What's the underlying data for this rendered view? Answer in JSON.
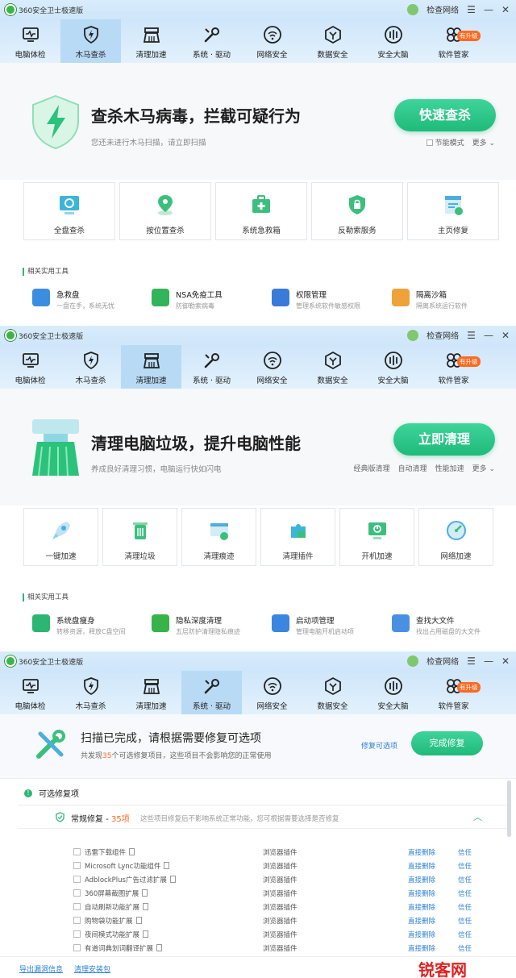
{
  "app_title": "360安全卫士极速版",
  "titlebar": {
    "network_check": "检查网络",
    "menu_icon": "☰",
    "min_icon": "—",
    "close_icon": "✕"
  },
  "nav": [
    {
      "label": "电脑体检",
      "icon": "monitor-icon"
    },
    {
      "label": "木马查杀",
      "icon": "shield-bolt-icon"
    },
    {
      "label": "清理加速",
      "icon": "broom-icon"
    },
    {
      "label": "系统 · 驱动",
      "icon": "wrench-icon"
    },
    {
      "label": "网络安全",
      "icon": "wifi-icon"
    },
    {
      "label": "数据安全",
      "icon": "data-shield-icon"
    },
    {
      "label": "安全大脑",
      "icon": "brain-icon"
    },
    {
      "label": "软件管家",
      "icon": "apps-icon"
    }
  ],
  "nav_badge": "有升级",
  "panel1": {
    "title": "查杀木马病毒，拦截可疑行为",
    "subtitle": "您还未进行木马扫描，请立即扫描",
    "button": "快速查杀",
    "opts": [
      "节能模式",
      "更多"
    ],
    "cards": [
      "全盘查杀",
      "按位置查杀",
      "系统急救箱",
      "反勒索服务",
      "主页修复"
    ],
    "tools_header": "相关实用工具",
    "tools": [
      {
        "name": "急救盘",
        "desc": "一盘在手，系统无忧",
        "color": "#3c8de0"
      },
      {
        "name": "NSA免疫工具",
        "desc": "防御勒索病毒",
        "color": "#34b45a"
      },
      {
        "name": "权限管理",
        "desc": "管理系统软件敏感权限",
        "color": "#3a7ad9"
      },
      {
        "name": "隔离沙箱",
        "desc": "隔离系统运行软件",
        "color": "#f0a23a"
      }
    ]
  },
  "panel2": {
    "title": "清理电脑垃圾，提升电脑性能",
    "subtitle": "养成良好清理习惯，电脑运行快如闪电",
    "button": "立即清理",
    "opts": [
      "经典版清理",
      "自动清理",
      "性能加速",
      "更多"
    ],
    "cards": [
      "一键加速",
      "清理垃圾",
      "清理痕迹",
      "清理插件",
      "开机加速",
      "网络加速"
    ],
    "tools_header": "相关实用工具",
    "tools": [
      {
        "name": "系统盘瘦身",
        "desc": "转移资源，释放C盘空间",
        "color": "#2bb673"
      },
      {
        "name": "隐私深度清理",
        "desc": "五层防护清理隐私痕迹",
        "color": "#37b34a"
      },
      {
        "name": "启动项管理",
        "desc": "管理电脑开机启动项",
        "color": "#3a86e0"
      },
      {
        "name": "查找大文件",
        "desc": "找出占用磁盘的大文件",
        "color": "#4a90e2"
      }
    ]
  },
  "panel3": {
    "title": "扫描已完成，请根据需要修复可选项",
    "subtitle_pre": "共发现",
    "count": "35",
    "subtitle_post": "个可选修复项目，这些项目不会影响您的正常使用",
    "repair_link": "修复可选项",
    "button": "完成修复",
    "section_title": "可选修复项",
    "group_title": "常规修复 - ",
    "group_count": "35项",
    "group_desc": "这些项目修复后不影响系统正常功能，您可根据需要选择是否修复",
    "rows": [
      {
        "name": "迅雷下载组件",
        "type": "浏览器插件",
        "a1": "直接删除",
        "a2": "信任"
      },
      {
        "name": "Microsoft Lync功能组件",
        "type": "浏览器插件",
        "a1": "直接删除",
        "a2": "信任"
      },
      {
        "name": "AdblockPlus广告过滤扩展",
        "type": "浏览器插件",
        "a1": "直接删除",
        "a2": "信任"
      },
      {
        "name": "360屏幕截图扩展",
        "type": "浏览器插件",
        "a1": "直接删除",
        "a2": "信任"
      },
      {
        "name": "自动刷新功能扩展",
        "type": "浏览器插件",
        "a1": "直接删除",
        "a2": "信任"
      },
      {
        "name": "购物袋功能扩展",
        "type": "浏览器插件",
        "a1": "直接删除",
        "a2": "信任"
      },
      {
        "name": "夜间模式功能扩展",
        "type": "浏览器插件",
        "a1": "直接删除",
        "a2": "信任"
      },
      {
        "name": "有道词典划词翻译扩展",
        "type": "浏览器插件",
        "a1": "直接删除",
        "a2": "信任"
      }
    ],
    "footer_links": [
      "导出漏洞信息",
      "清理安装包"
    ],
    "watermark": "锐客网"
  },
  "colors": {
    "accent": "#1fba7a",
    "link": "#2a7fd6",
    "orange": "#ff6a21"
  }
}
